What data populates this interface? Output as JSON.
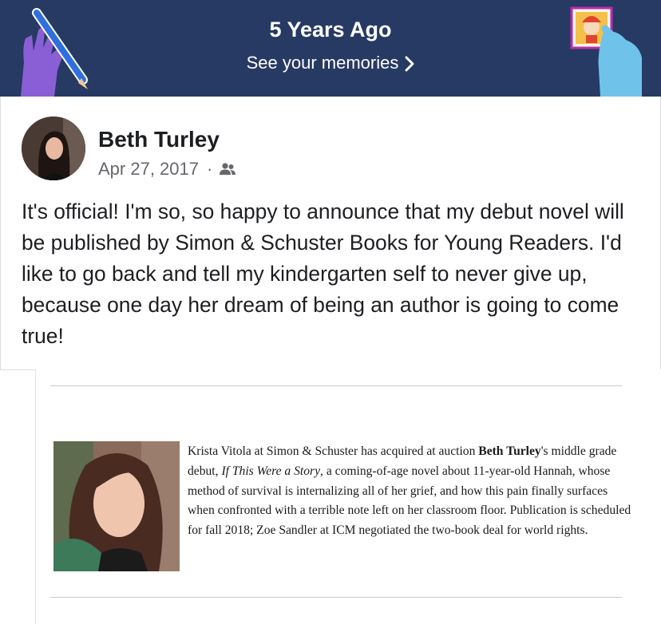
{
  "banner": {
    "title": "5 Years Ago",
    "link_label": "See your memories",
    "background_color": "#263a63",
    "left_art_icon": "hand-holding-pencil-icon",
    "right_art_icon": "hand-holding-photo-icon"
  },
  "post": {
    "author_name": "Beth Turley",
    "date": "Apr 27, 2017",
    "separator": "·",
    "audience_icon": "friends-icon",
    "text": "It's official! I'm so, so happy to announce that my debut novel will be published by Simon & Schuster Books for Young Readers. I'd like to go back and tell my kindergarten self to never give up, because one day her dream of being an author is going to come true!"
  },
  "clipping": {
    "text_1": "Krista Vitola at Simon & Schuster has acquired at auction ",
    "bold_1": "Beth Turley",
    "text_2": "'s middle grade debut, ",
    "italic_title": "If This Were a Story",
    "text_3": ", a coming-of-age novel about 11-year-old Hannah, whose method of survival is internalizing all of her grief, and how this pain finally surfaces when confronted with a terrible note left on her classroom floor. Publication is scheduled for fall 2018; Zoe Sandler at ICM negotiated the two-book deal for world rights."
  }
}
